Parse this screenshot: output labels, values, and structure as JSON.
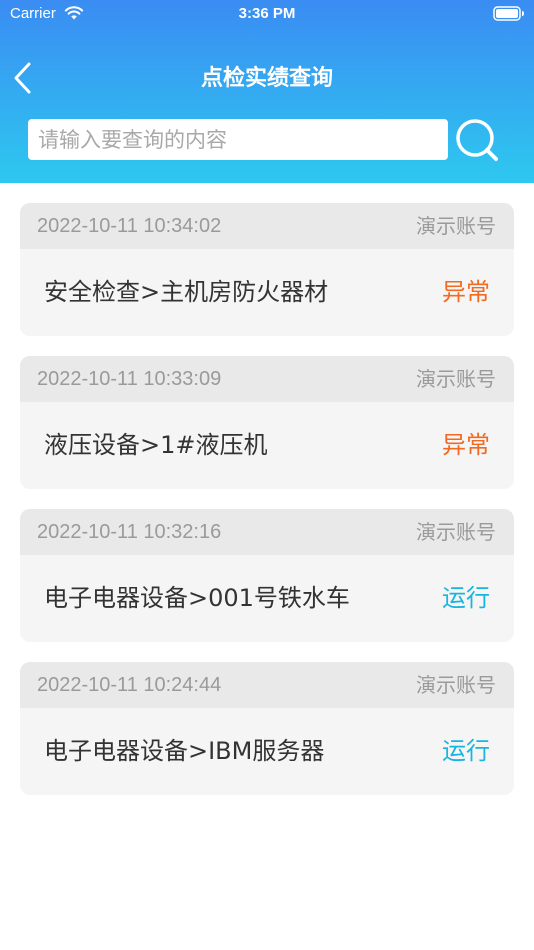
{
  "status_bar": {
    "carrier": "Carrier",
    "time": "3:36 PM",
    "wifi_icon": "wifi-icon",
    "battery_icon": "battery-icon"
  },
  "header": {
    "title": "点检实绩查询",
    "back_icon": "chevron-left-icon",
    "gradient_top": "#3a8cf2",
    "gradient_bottom": "#2ec8f0"
  },
  "search": {
    "value": "",
    "placeholder": "请输入要查询的内容",
    "icon": "search-icon"
  },
  "colors": {
    "abnormal": "#f26a21",
    "running": "#1ab4e0",
    "card_bg": "#f5f5f5",
    "card_head_bg": "#e9e9e9"
  },
  "records": [
    {
      "time": "2022-10-11 10:34:02",
      "account": "演示账号",
      "name": "安全检查>主机房防火器材",
      "status": "异常",
      "status_color": "#f26a21"
    },
    {
      "time": "2022-10-11 10:33:09",
      "account": "演示账号",
      "name": "液压设备>1#液压机",
      "status": "异常",
      "status_color": "#f26a21"
    },
    {
      "time": "2022-10-11 10:32:16",
      "account": "演示账号",
      "name": "电子电器设备>001号铁水车",
      "status": "运行",
      "status_color": "#1ab4e0"
    },
    {
      "time": "2022-10-11 10:24:44",
      "account": "演示账号",
      "name": "电子电器设备>IBM服务器",
      "status": "运行",
      "status_color": "#1ab4e0"
    }
  ]
}
